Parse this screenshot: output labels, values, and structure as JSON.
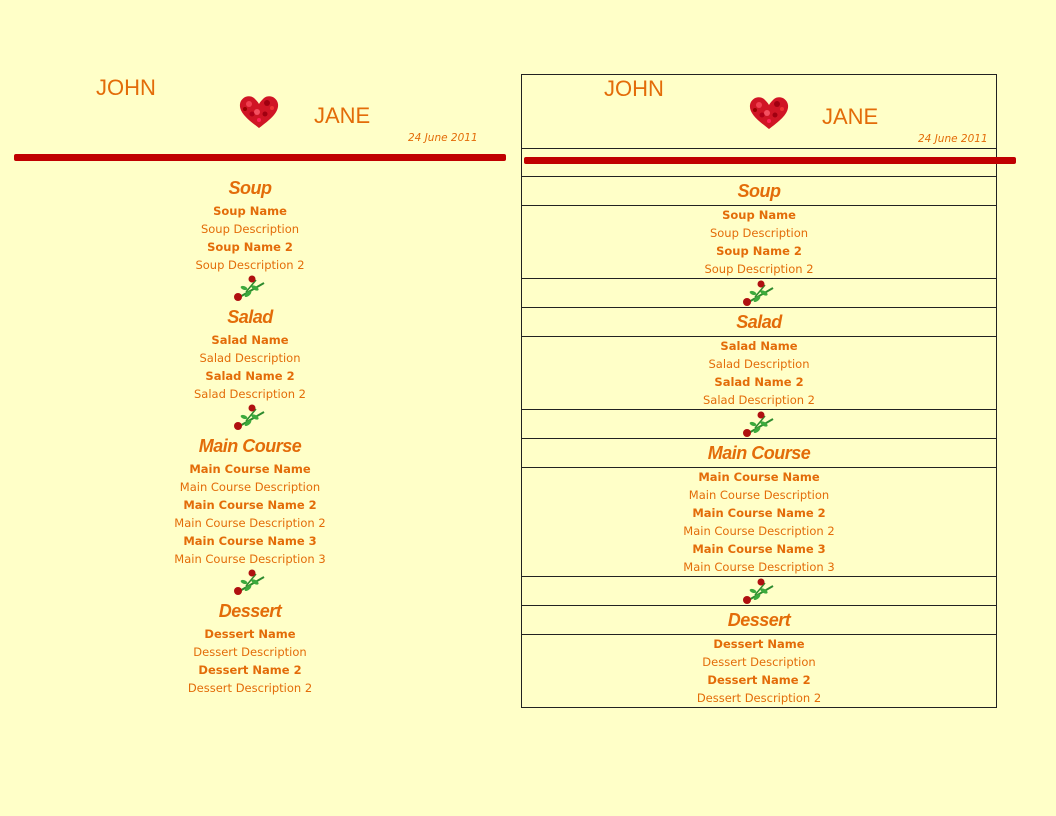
{
  "header": {
    "name1": "JOHN",
    "name2": "JANE",
    "date": "24 June 2011"
  },
  "icons": {
    "heart": "heart-icon",
    "rose": "rose-icon"
  },
  "colors": {
    "background": "#ffffc8",
    "text": "#e36c09",
    "accent_line": "#c00000",
    "border": "#222222"
  },
  "courses": [
    {
      "title": "Soup",
      "items": [
        {
          "name": "Soup Name",
          "description": "Soup Description"
        },
        {
          "name": "Soup Name 2",
          "description": "Soup Description 2"
        }
      ]
    },
    {
      "title": "Salad",
      "items": [
        {
          "name": "Salad Name",
          "description": "Salad Description"
        },
        {
          "name": "Salad Name 2",
          "description": "Salad Description 2"
        }
      ]
    },
    {
      "title": "Main Course",
      "items": [
        {
          "name": "Main Course Name",
          "description": "Main Course Description"
        },
        {
          "name": "Main Course Name 2",
          "description": "Main Course Description 2"
        },
        {
          "name": "Main Course Name 3",
          "description": "Main Course Description 3"
        }
      ]
    },
    {
      "title": "Dessert",
      "items": [
        {
          "name": "Dessert Name",
          "description": "Dessert Description"
        },
        {
          "name": "Dessert Name 2",
          "description": "Dessert Description 2"
        }
      ]
    }
  ]
}
